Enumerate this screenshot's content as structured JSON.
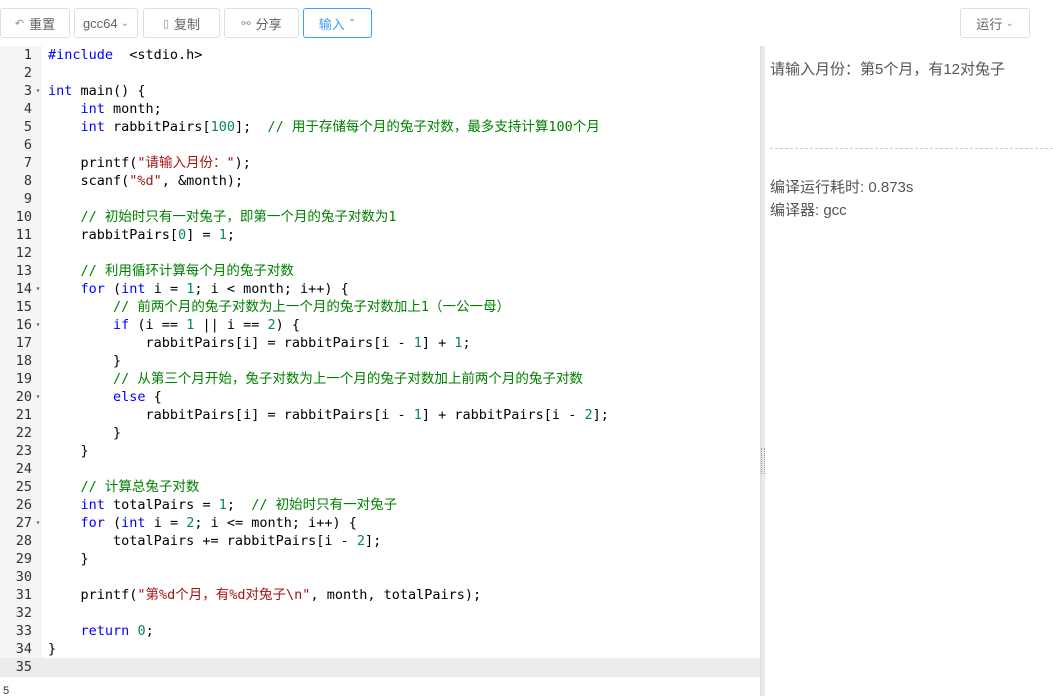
{
  "toolbar": {
    "reset_label": "重置",
    "compiler_value": "gcc64",
    "copy_label": "复制",
    "share_label": "分享",
    "input_label": "输入",
    "run_label": "运行"
  },
  "editor": {
    "lines": [
      {
        "n": "1",
        "fold": ""
      },
      {
        "n": "2",
        "fold": ""
      },
      {
        "n": "3",
        "fold": "▾"
      },
      {
        "n": "4",
        "fold": ""
      },
      {
        "n": "5",
        "fold": ""
      },
      {
        "n": "6",
        "fold": ""
      },
      {
        "n": "7",
        "fold": ""
      },
      {
        "n": "8",
        "fold": ""
      },
      {
        "n": "9",
        "fold": ""
      },
      {
        "n": "10",
        "fold": ""
      },
      {
        "n": "11",
        "fold": ""
      },
      {
        "n": "12",
        "fold": ""
      },
      {
        "n": "13",
        "fold": ""
      },
      {
        "n": "14",
        "fold": "▾"
      },
      {
        "n": "15",
        "fold": ""
      },
      {
        "n": "16",
        "fold": "▾"
      },
      {
        "n": "17",
        "fold": ""
      },
      {
        "n": "18",
        "fold": ""
      },
      {
        "n": "19",
        "fold": ""
      },
      {
        "n": "20",
        "fold": "▾"
      },
      {
        "n": "21",
        "fold": ""
      },
      {
        "n": "22",
        "fold": ""
      },
      {
        "n": "23",
        "fold": ""
      },
      {
        "n": "24",
        "fold": ""
      },
      {
        "n": "25",
        "fold": ""
      },
      {
        "n": "26",
        "fold": ""
      },
      {
        "n": "27",
        "fold": "▾"
      },
      {
        "n": "28",
        "fold": ""
      },
      {
        "n": "29",
        "fold": ""
      },
      {
        "n": "30",
        "fold": ""
      },
      {
        "n": "31",
        "fold": ""
      },
      {
        "n": "32",
        "fold": ""
      },
      {
        "n": "33",
        "fold": ""
      },
      {
        "n": "34",
        "fold": ""
      },
      {
        "n": "35",
        "fold": ""
      }
    ],
    "code": [
      [
        [
          "pp",
          "#include"
        ],
        [
          "",
          "  <stdio.h>"
        ]
      ],
      [],
      [
        [
          "ty",
          "int"
        ],
        [
          "",
          " main() {"
        ]
      ],
      [
        [
          "",
          "    "
        ],
        [
          "ty",
          "int"
        ],
        [
          "",
          " month;"
        ]
      ],
      [
        [
          "",
          "    "
        ],
        [
          "ty",
          "int"
        ],
        [
          "",
          " rabbitPairs["
        ],
        [
          "num",
          "100"
        ],
        [
          "",
          "];  "
        ],
        [
          "cm",
          "// 用于存储每个月的兔子对数，最多支持计算100个月"
        ]
      ],
      [],
      [
        [
          "",
          "    printf("
        ],
        [
          "str",
          "\"请输入月份：\""
        ],
        [
          "",
          ");"
        ]
      ],
      [
        [
          "",
          "    scanf("
        ],
        [
          "str",
          "\"%d\""
        ],
        [
          "",
          ", &month);"
        ]
      ],
      [],
      [
        [
          "",
          "    "
        ],
        [
          "cm",
          "// 初始时只有一对兔子，即第一个月的兔子对数为1"
        ]
      ],
      [
        [
          "",
          "    rabbitPairs["
        ],
        [
          "num",
          "0"
        ],
        [
          "",
          "] = "
        ],
        [
          "num",
          "1"
        ],
        [
          "",
          ";"
        ]
      ],
      [],
      [
        [
          "",
          "    "
        ],
        [
          "cm",
          "// 利用循环计算每个月的兔子对数"
        ]
      ],
      [
        [
          "",
          "    "
        ],
        [
          "kw",
          "for"
        ],
        [
          "",
          " ("
        ],
        [
          "ty",
          "int"
        ],
        [
          "",
          " i = "
        ],
        [
          "num",
          "1"
        ],
        [
          "",
          "; i < month; i++) {"
        ]
      ],
      [
        [
          "",
          "        "
        ],
        [
          "cm",
          "// 前两个月的兔子对数为上一个月的兔子对数加上1（一公一母）"
        ]
      ],
      [
        [
          "",
          "        "
        ],
        [
          "kw",
          "if"
        ],
        [
          "",
          " (i == "
        ],
        [
          "num",
          "1"
        ],
        [
          "",
          " || i == "
        ],
        [
          "num",
          "2"
        ],
        [
          "",
          ") {"
        ]
      ],
      [
        [
          "",
          "            rabbitPairs[i] = rabbitPairs[i - "
        ],
        [
          "num",
          "1"
        ],
        [
          "",
          "] + "
        ],
        [
          "num",
          "1"
        ],
        [
          "",
          ";"
        ]
      ],
      [
        [
          "",
          "        }"
        ]
      ],
      [
        [
          "",
          "        "
        ],
        [
          "cm",
          "// 从第三个月开始，兔子对数为上一个月的兔子对数加上前两个月的兔子对数"
        ]
      ],
      [
        [
          "",
          "        "
        ],
        [
          "kw",
          "else"
        ],
        [
          "",
          " {"
        ]
      ],
      [
        [
          "",
          "            rabbitPairs[i] = rabbitPairs[i - "
        ],
        [
          "num",
          "1"
        ],
        [
          "",
          "] + rabbitPairs[i - "
        ],
        [
          "num",
          "2"
        ],
        [
          "",
          "];"
        ]
      ],
      [
        [
          "",
          "        }"
        ]
      ],
      [
        [
          "",
          "    }"
        ]
      ],
      [],
      [
        [
          "",
          "    "
        ],
        [
          "cm",
          "// 计算总兔子对数"
        ]
      ],
      [
        [
          "",
          "    "
        ],
        [
          "ty",
          "int"
        ],
        [
          "",
          " totalPairs = "
        ],
        [
          "num",
          "1"
        ],
        [
          "",
          ";  "
        ],
        [
          "cm",
          "// 初始时只有一对兔子"
        ]
      ],
      [
        [
          "",
          "    "
        ],
        [
          "kw",
          "for"
        ],
        [
          "",
          " ("
        ],
        [
          "ty",
          "int"
        ],
        [
          "",
          " i = "
        ],
        [
          "num",
          "2"
        ],
        [
          "",
          "; i <= month; i++) {"
        ]
      ],
      [
        [
          "",
          "        totalPairs += rabbitPairs[i - "
        ],
        [
          "num",
          "2"
        ],
        [
          "",
          "];"
        ]
      ],
      [
        [
          "",
          "    }"
        ]
      ],
      [],
      [
        [
          "",
          "    printf("
        ],
        [
          "str",
          "\"第%d个月，有%d对兔子\\n\""
        ],
        [
          "",
          ", month, totalPairs);"
        ]
      ],
      [],
      [
        [
          "",
          "    "
        ],
        [
          "kw",
          "return"
        ],
        [
          "",
          " "
        ],
        [
          "num",
          "0"
        ],
        [
          "",
          ";"
        ]
      ],
      [
        [
          "",
          "}"
        ]
      ],
      []
    ]
  },
  "output": {
    "text": "请输入月份：第5个月，有12对兔子",
    "compile_time": "编译运行耗时: 0.873s",
    "compiler": "编译器: gcc"
  },
  "stdin": {
    "value": "5"
  }
}
